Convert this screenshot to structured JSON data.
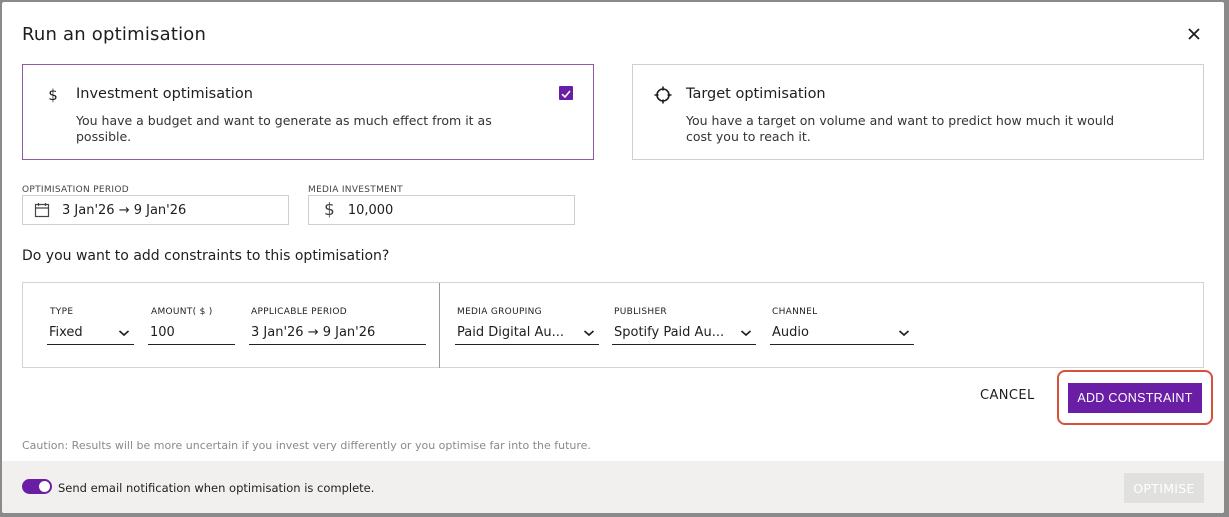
{
  "dialog": {
    "title": "Run an optimisation"
  },
  "cards": {
    "investment": {
      "icon": "dollar-icon",
      "title": "Investment optimisation",
      "description": "You have a budget and want to generate as much effect from it as possible.",
      "selected": true
    },
    "target": {
      "icon": "crosshair-icon",
      "title": "Target optimisation",
      "description": "You have a target on volume and want to predict how much it would cost you to reach it.",
      "selected": false
    }
  },
  "fields": {
    "period_label": "OPTIMISATION PERIOD",
    "period_value": "3 Jan'26 → 9 Jan'26",
    "investment_label": "MEDIA INVESTMENT",
    "investment_currency": "$",
    "investment_value": "10,000"
  },
  "constraints": {
    "question": "Do you want to add constraints to this optimisation?",
    "type_label": "TYPE",
    "type_value": "Fixed",
    "amount_label": "AMOUNT( $ )",
    "amount_value": "100",
    "period_label": "APPLICABLE PERIOD",
    "period_value": "3 Jan'26 → 9 Jan'26",
    "media_grouping_label": "MEDIA GROUPING",
    "media_grouping_value": "Paid Digital Au...",
    "publisher_label": "PUBLISHER",
    "publisher_value": "Spotify Paid Au...",
    "channel_label": "CHANNEL",
    "channel_value": "Audio"
  },
  "actions": {
    "cancel": "CANCEL",
    "add_constraint": "ADD CONSTRAINT",
    "optimise": "OPTIMISE"
  },
  "caution": "Caution: Results will be more uncertain if you invest very differently or you optimise far into the future.",
  "footer": {
    "email_toggle_on": true,
    "email_text": "Send email notification when optimisation is complete."
  },
  "colors": {
    "accent": "#6a1ea6",
    "highlight": "#d9503a"
  }
}
